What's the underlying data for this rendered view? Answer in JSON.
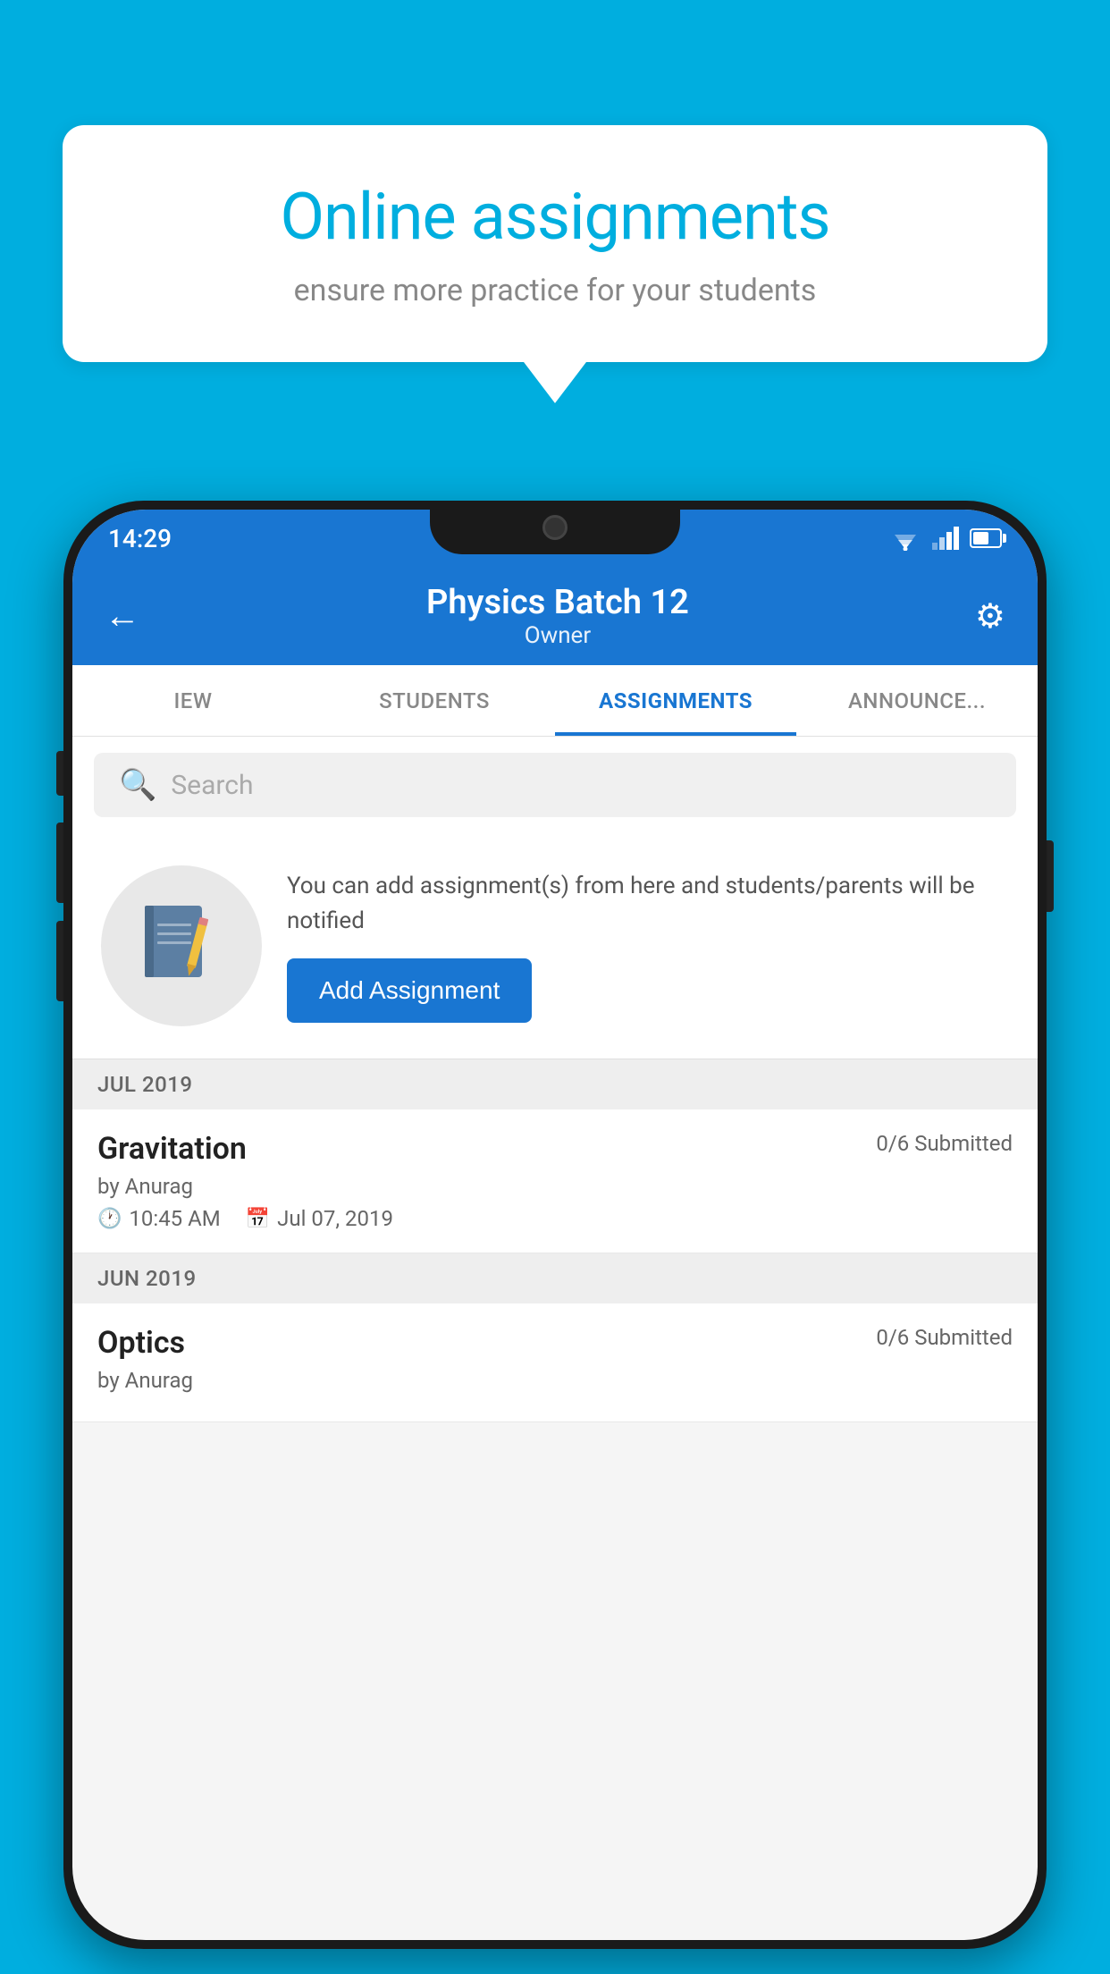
{
  "background_color": "#00AEDF",
  "speech_bubble": {
    "title": "Online assignments",
    "subtitle": "ensure more practice for your students"
  },
  "phone": {
    "status_bar": {
      "time": "14:29"
    },
    "app_bar": {
      "title": "Physics Batch 12",
      "subtitle": "Owner",
      "back_label": "←",
      "settings_label": "⚙"
    },
    "tabs": [
      {
        "label": "IEW",
        "active": false
      },
      {
        "label": "STUDENTS",
        "active": false
      },
      {
        "label": "ASSIGNMENTS",
        "active": true
      },
      {
        "label": "ANNOUNCE...",
        "active": false
      }
    ],
    "search": {
      "placeholder": "Search"
    },
    "promo": {
      "text": "You can add assignment(s) from here and students/parents will be notified",
      "button_label": "Add Assignment"
    },
    "sections": [
      {
        "month_label": "JUL 2019",
        "assignments": [
          {
            "title": "Gravitation",
            "submitted": "0/6 Submitted",
            "author": "by Anurag",
            "time": "10:45 AM",
            "date": "Jul 07, 2019"
          }
        ]
      },
      {
        "month_label": "JUN 2019",
        "assignments": [
          {
            "title": "Optics",
            "submitted": "0/6 Submitted",
            "author": "by Anurag",
            "time": "",
            "date": ""
          }
        ]
      }
    ]
  }
}
